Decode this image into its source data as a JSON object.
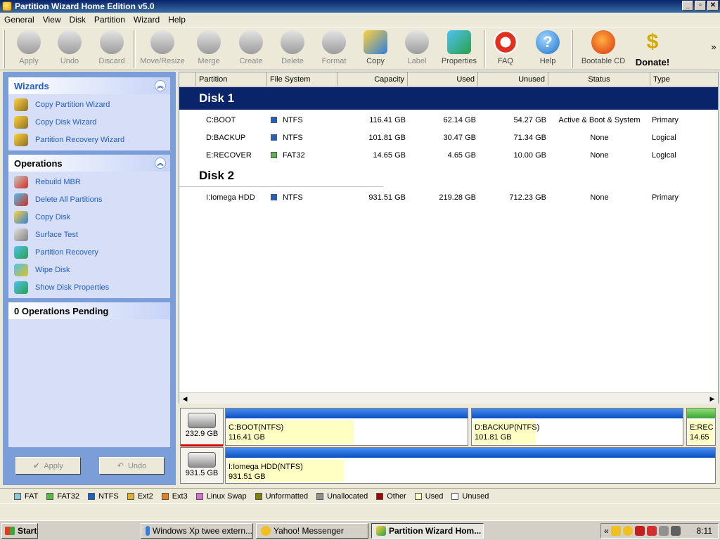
{
  "window": {
    "title": "Partition Wizard Home Edition v5.0",
    "min": "_",
    "max": "▫",
    "close": "✕"
  },
  "menu": [
    "General",
    "View",
    "Disk",
    "Partition",
    "Wizard",
    "Help"
  ],
  "toolbar": {
    "apply": "Apply",
    "undo": "Undo",
    "discard": "Discard",
    "move_resize": "Move/Resize",
    "merge": "Merge",
    "create": "Create",
    "delete": "Delete",
    "format": "Format",
    "copy": "Copy",
    "label": "Label",
    "properties": "Properties",
    "faq": "FAQ",
    "help": "Help",
    "bootable_cd": "Bootable CD",
    "donate": "Donate!",
    "more": "»"
  },
  "sidebar": {
    "wizards_title": "Wizards",
    "wizards": [
      "Copy Partition Wizard",
      "Copy Disk Wizard",
      "Partition Recovery Wizard"
    ],
    "operations_title": "Operations",
    "operations": [
      "Rebuild MBR",
      "Delete All Partitions",
      "Copy Disk",
      "Surface Test",
      "Partition Recovery",
      "Wipe Disk",
      "Show Disk Properties"
    ],
    "pending_title": "0 Operations Pending",
    "apply": "Apply",
    "undo": "Undo"
  },
  "columns": {
    "partition": "Partition",
    "filesystem": "File System",
    "capacity": "Capacity",
    "used": "Used",
    "unused": "Unused",
    "status": "Status",
    "type": "Type"
  },
  "disks": {
    "disk1": "Disk 1",
    "disk2": "Disk 2"
  },
  "rows": [
    {
      "partition": "C:BOOT",
      "fs": "NTFS",
      "capacity": "116.41 GB",
      "used": "62.14 GB",
      "unused": "54.27 GB",
      "status": "Active & Boot & System",
      "type": "Primary",
      "color": "#1f5fc8"
    },
    {
      "partition": "D:BACKUP",
      "fs": "NTFS",
      "capacity": "101.81 GB",
      "used": "30.47 GB",
      "unused": "71.34 GB",
      "status": "None",
      "type": "Logical",
      "color": "#1f5fc8"
    },
    {
      "partition": "E:RECOVER",
      "fs": "FAT32",
      "capacity": "14.65 GB",
      "used": "4.65 GB",
      "unused": "10.00 GB",
      "status": "None",
      "type": "Logical",
      "color": "#58b848"
    },
    {
      "partition": "I:Iomega HDD",
      "fs": "NTFS",
      "capacity": "931.51 GB",
      "used": "219.28 GB",
      "unused": "712.23 GB",
      "status": "None",
      "type": "Primary",
      "color": "#1f5fc8"
    }
  ],
  "map": {
    "disk1_size": "232.9 GB",
    "disk2_size": "931.5 GB",
    "c_label": "C:BOOT(NTFS)",
    "c_size": "116.41 GB",
    "d_label": "D:BACKUP(NTFS)",
    "d_size": "101.81 GB",
    "e_label": "E:REC",
    "e_size": "14.65",
    "i_label": "I:Iomega HDD(NTFS)",
    "i_size": "931.51 GB",
    "c_used_fraction": 0.53,
    "d_used_fraction": 0.3,
    "i_used_fraction": 0.24
  },
  "legend": [
    {
      "label": "FAT",
      "color": "#8fc6d6"
    },
    {
      "label": "FAT32",
      "color": "#58b848"
    },
    {
      "label": "NTFS",
      "color": "#1f5fc8"
    },
    {
      "label": "Ext2",
      "color": "#e0b030"
    },
    {
      "label": "Ext3",
      "color": "#e08020"
    },
    {
      "label": "Linux Swap",
      "color": "#d070d0"
    },
    {
      "label": "Unformatted",
      "color": "#808000"
    },
    {
      "label": "Unallocated",
      "color": "#909090"
    },
    {
      "label": "Other",
      "color": "#a00000"
    },
    {
      "label": "Used",
      "color": "#ffffc4"
    },
    {
      "label": "Unused",
      "color": "#ffffff"
    }
  ],
  "taskbar": {
    "start": "Start",
    "tasks": [
      "Windows Xp twee extern...",
      "Yahoo! Messenger",
      "Partition Wizard Hom..."
    ],
    "tray_arrow": "«",
    "clock": "8:11"
  }
}
